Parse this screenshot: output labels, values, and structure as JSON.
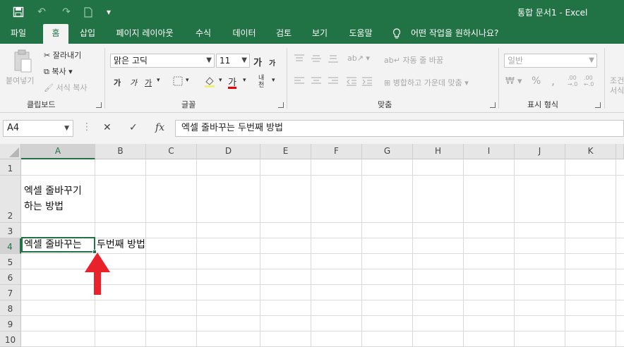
{
  "window": {
    "title": "통합 문서1  -  Excel"
  },
  "quick_access": {
    "save": "save-icon",
    "undo": "↶",
    "redo": "↷",
    "new": "new-document-icon",
    "customize": "▾"
  },
  "tabs": [
    "파일",
    "홈",
    "삽입",
    "페이지 레이아웃",
    "수식",
    "데이터",
    "검토",
    "보기",
    "도움말"
  ],
  "active_tab": "홈",
  "tell_me": "어떤 작업을 원하시나요?",
  "ribbon": {
    "clipboard": {
      "paste": "붙여넣기",
      "cut": "잘라내기",
      "copy": "복사",
      "format_painter": "서식 복사",
      "label": "클립보드"
    },
    "font": {
      "name": "맑은 고딕",
      "size": "11",
      "grow": "가",
      "shrink": "가",
      "bold": "가",
      "italic": "가",
      "underline": "가",
      "font_color": "가",
      "phonetic": "내천",
      "label": "글꼴"
    },
    "alignment": {
      "wrap_text": "자동 줄 바꿈",
      "merge_center": "병합하고 가운데 맞춤",
      "label": "맞춤"
    },
    "number": {
      "format": "일반",
      "currency": "₩",
      "percent": "%",
      "comma": ",",
      "label": "표시 형식"
    },
    "styles": {
      "conditional": "조건",
      "conditional2": "서식"
    }
  },
  "formula_bar": {
    "name_box": "A4",
    "cancel": "✕",
    "enter": "✓",
    "fx": "fx",
    "content": "엑셀 줄바꾸는 두번째 방법"
  },
  "grid": {
    "columns": [
      "A",
      "B",
      "C",
      "D",
      "E",
      "F",
      "G",
      "H",
      "I",
      "J",
      "K"
    ],
    "rows": [
      "1",
      "2",
      "3",
      "4",
      "5",
      "6",
      "7",
      "8",
      "9",
      "10"
    ],
    "selected_column": "A",
    "selected_row": "4",
    "cells": {
      "A2_line1": "엑셀 줄바꾸기",
      "A2_line2": "하는 방법",
      "A4_part1": "엑셀 줄바꾸는",
      "A4_part2": "두번째 방법"
    }
  },
  "colors": {
    "brand": "#217346",
    "arrow": "#e8212b"
  }
}
